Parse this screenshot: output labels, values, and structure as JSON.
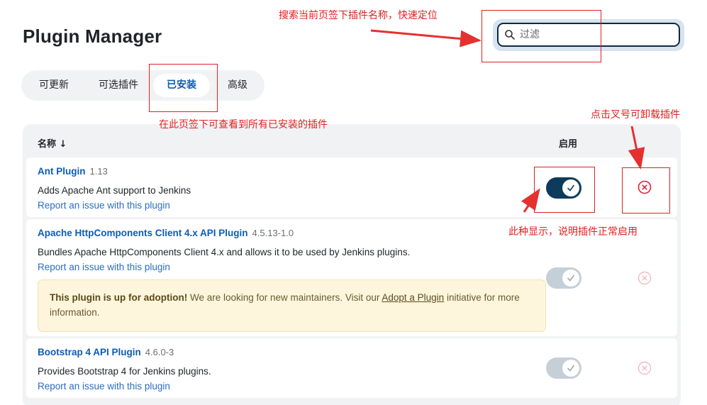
{
  "header": {
    "title": "Plugin Manager",
    "search_placeholder": "过滤"
  },
  "tabs": [
    {
      "label": "可更新",
      "active": false
    },
    {
      "label": "可选插件",
      "active": false
    },
    {
      "label": "已安装",
      "active": true
    },
    {
      "label": "高级",
      "active": false
    }
  ],
  "table": {
    "col_name": "名称 ↓",
    "col_enabled": "启用",
    "rows": [
      {
        "name": "Ant Plugin",
        "version": "1.13",
        "description": "Adds Apache Ant support to Jenkins",
        "report": "Report an issue with this plugin",
        "enabled": true,
        "toggle_state": "on"
      },
      {
        "name": "Apache HttpComponents Client 4.x API Plugin",
        "version": "4.5.13-1.0",
        "description": "Bundles Apache HttpComponents Client 4.x and allows it to be used by Jenkins plugins.",
        "report": "Report an issue with this plugin",
        "enabled": true,
        "toggle_state": "disabled",
        "adoption": {
          "bold": "This plugin is up for adoption!",
          "text_before_link": " We are looking for new maintainers. Visit our ",
          "link": "Adopt a Plugin",
          "text_after_link": " initiative for more information."
        }
      },
      {
        "name": "Bootstrap 4 API Plugin",
        "version": "4.6.0-3",
        "description": "Provides Bootstrap 4 for Jenkins plugins.",
        "report": "Report an issue with this plugin",
        "enabled": true,
        "toggle_state": "disabled"
      }
    ]
  },
  "annotations": {
    "search_note": "搜索当前页签下插件名称，快速定位",
    "tab_note": "在此页签下可查看到所有已安装的插件",
    "uninstall_note": "点击叉号可卸载插件",
    "enabled_note": "此种显示，说明插件正常启用"
  },
  "colors": {
    "accent": "#0b5cb8",
    "toggle_on": "#0e3b5c",
    "toggle_disabled": "#c5cfd8",
    "uninstall": "#d9243a",
    "annotation": "#e02020"
  }
}
